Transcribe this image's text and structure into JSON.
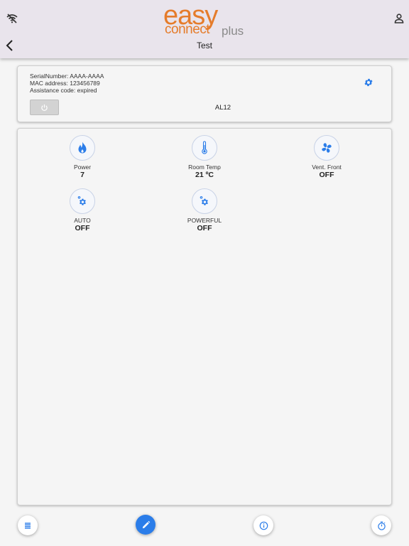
{
  "header": {
    "logo": {
      "easy": "easy",
      "connect": "connect",
      "plus": "plus"
    },
    "title": "Test",
    "icons": {
      "left": "wifi-off-icon",
      "right": "person-icon",
      "back": "chevron-left-icon"
    }
  },
  "device": {
    "serial": "SerialNumber: AAAA-AAAA",
    "mac": "MAC address: 123456789",
    "assistance": "Assistance code: expired",
    "model": "AL12",
    "icons": {
      "settings": "gear-icon",
      "power": "power-icon"
    }
  },
  "tiles": [
    {
      "label": "Power",
      "value": "7",
      "icon": "flame-icon"
    },
    {
      "label": "Room Temp",
      "value": "21 ºC",
      "icon": "thermometer-icon"
    },
    {
      "label": "Vent. Front",
      "value": "OFF",
      "icon": "fan-icon"
    },
    {
      "label": "AUTO",
      "value": "OFF",
      "icon": "gears-icon"
    },
    {
      "label": "POWERFUL",
      "value": "OFF",
      "icon": "gears-icon"
    }
  ],
  "bottom_bar": [
    {
      "icon": "list-icon"
    },
    {
      "icon": "pencil-icon",
      "active": true
    },
    {
      "icon": "info-icon"
    },
    {
      "icon": "timer-icon"
    }
  ],
  "colors": {
    "accent": "#2b7de9",
    "brand": "#e57c2b",
    "header_bg": "#e9e4ec"
  }
}
